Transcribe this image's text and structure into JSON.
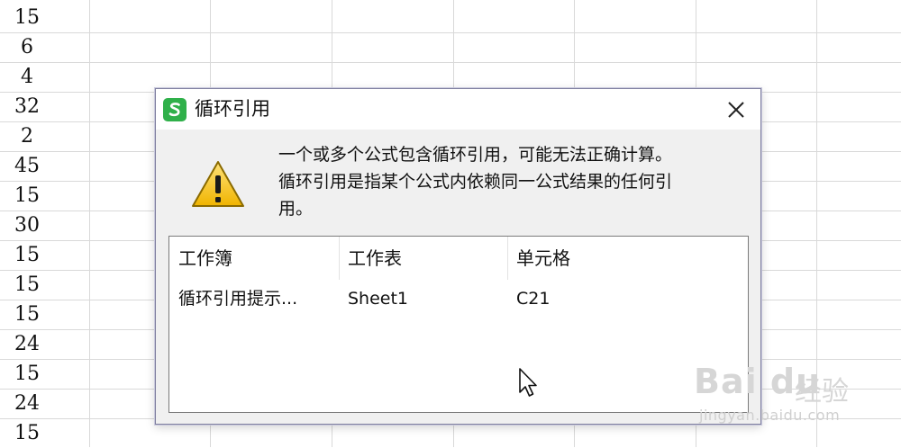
{
  "sheet": {
    "column_values": [
      "15",
      "6",
      "4",
      "32",
      "2",
      "45",
      "15",
      "30",
      "15",
      "15",
      "15",
      "24",
      "15",
      "24",
      "15"
    ]
  },
  "dialog": {
    "title": "循环引用",
    "message_lines": [
      "一个或多个公式包含循环引用，可能无法正确计算。",
      "循环引用是指某个公式内依赖同一公式结果的任何引",
      "用。"
    ],
    "table": {
      "headers": [
        "工作簿",
        "工作表",
        "单元格"
      ],
      "rows": [
        [
          "循环引用提示...",
          "Sheet1",
          "C21"
        ]
      ]
    },
    "icons": {
      "app": "wps-spreadsheet-icon",
      "close": "close-icon",
      "warning": "warning-icon"
    }
  },
  "watermark": {
    "brand": "Bai du",
    "product": "经验",
    "url": "jingyan.baidu.com"
  },
  "colors": {
    "app_icon": "#2fb04a",
    "warning_fill": "#f2c01e",
    "dialog_bg": "#f0f0f0",
    "grid": "#d9d9d9"
  }
}
